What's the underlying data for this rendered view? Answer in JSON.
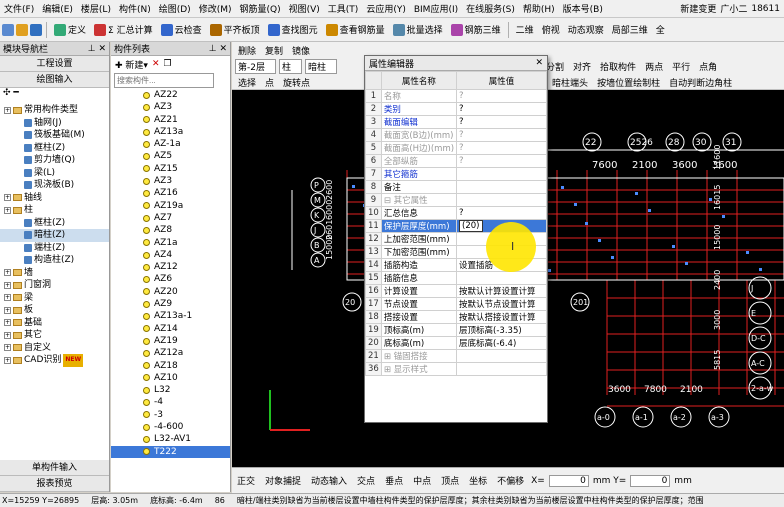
{
  "menubar": {
    "items": [
      "文件(F)",
      "编辑(E)",
      "楼层(L)",
      "构件(N)",
      "绘图(D)",
      "修改(M)",
      "钢筋量(Q)",
      "视图(V)",
      "工具(T)",
      "云应用(Y)",
      "BIM应用(I)",
      "在线服务(S)",
      "帮助(H)",
      "版本号(B)"
    ],
    "new_change": "新建变更",
    "user": "广小二",
    "phone": "18611"
  },
  "toolbar1": {
    "items": [
      "定义",
      "Σ 汇总计算",
      "云检查",
      "平齐板顶",
      "查找图元",
      "查看钢筋量",
      "批量选择",
      "钢筋三维"
    ],
    "right": [
      "二维",
      "俯视",
      "动态观察",
      "局部三维",
      "全"
    ]
  },
  "toolbar2": {
    "row1": [
      "删除",
      "复制",
      "镜像"
    ],
    "floor": "第-2层",
    "type": "柱",
    "sub": "暗柱",
    "right1": [
      "分割",
      "对齐"
    ],
    "row2": [
      "选择",
      "点",
      "旋转点"
    ],
    "right2": [
      "拾取构件",
      "两点",
      "平行",
      "点角"
    ],
    "row3": [
      "暗柱端头",
      "按墙位置绘制柱",
      "自动判断边角柱"
    ]
  },
  "leftpanel": {
    "title": "模块导航栏",
    "btn1": "工程设置",
    "btn2": "绘图输入",
    "tree": [
      {
        "label": "常用构件类型",
        "level": 1,
        "kind": "folder"
      },
      {
        "label": "轴网(J)",
        "level": 2,
        "kind": "leaf"
      },
      {
        "label": "筏板基础(M)",
        "level": 2,
        "kind": "leaf"
      },
      {
        "label": "框柱(Z)",
        "level": 2,
        "kind": "leaf"
      },
      {
        "label": "剪力墙(Q)",
        "level": 2,
        "kind": "leaf"
      },
      {
        "label": "梁(L)",
        "level": 2,
        "kind": "leaf"
      },
      {
        "label": "现浇板(B)",
        "level": 2,
        "kind": "leaf"
      },
      {
        "label": "轴线",
        "level": 1,
        "kind": "folder"
      },
      {
        "label": "柱",
        "level": 1,
        "kind": "folder"
      },
      {
        "label": "框柱(Z)",
        "level": 2,
        "kind": "leaf"
      },
      {
        "label": "暗柱(Z)",
        "level": 2,
        "kind": "leaf",
        "selected": true
      },
      {
        "label": "端柱(Z)",
        "level": 2,
        "kind": "leaf"
      },
      {
        "label": "构造柱(Z)",
        "level": 2,
        "kind": "leaf"
      },
      {
        "label": "墙",
        "level": 1,
        "kind": "folder"
      },
      {
        "label": "门窗洞",
        "level": 1,
        "kind": "folder"
      },
      {
        "label": "梁",
        "level": 1,
        "kind": "folder"
      },
      {
        "label": "板",
        "level": 1,
        "kind": "folder"
      },
      {
        "label": "基础",
        "level": 1,
        "kind": "folder"
      },
      {
        "label": "其它",
        "level": 1,
        "kind": "folder"
      },
      {
        "label": "自定义",
        "level": 1,
        "kind": "folder"
      },
      {
        "label": "CAD识别",
        "level": 1,
        "kind": "folder",
        "badge": "NEW"
      }
    ],
    "bottom1": "单构件输入",
    "bottom2": "报表预览"
  },
  "midpanel": {
    "title": "构件列表",
    "new_btn": "新建",
    "search_placeholder": "搜索构件...",
    "items": [
      "AZ22",
      "AZ3",
      "AZ21",
      "AZ13a",
      "AZ-1a",
      "AZ5",
      "AZ15",
      "AZ3",
      "AZ16",
      "AZ19a",
      "AZ7",
      "AZ8",
      "AZ1a",
      "AZ4",
      "AZ12",
      "AZ6",
      "AZ20",
      "AZ9",
      "AZ13a-1",
      "AZ14",
      "AZ19",
      "AZ12a",
      "AZ18",
      "AZ10",
      "L32",
      "-4",
      "-3",
      "-4-600",
      "L32-AV1",
      "T222"
    ],
    "selected_index": 29
  },
  "dialog": {
    "title": "属性编辑器",
    "col_name": "属性名称",
    "col_value": "属性值",
    "rows": [
      {
        "n": "1",
        "name": "名称",
        "value": "?",
        "style": "gray"
      },
      {
        "n": "2",
        "name": "类别",
        "value": "?",
        "style": "blue"
      },
      {
        "n": "3",
        "name": "截面编辑",
        "value": "?",
        "style": "blue"
      },
      {
        "n": "4",
        "name": "截面宽(B边)(mm)",
        "value": "?",
        "style": "gray"
      },
      {
        "n": "5",
        "name": "截面高(H边)(mm)",
        "value": "?",
        "style": "gray"
      },
      {
        "n": "6",
        "name": "全部纵筋",
        "value": "?",
        "style": "gray"
      },
      {
        "n": "7",
        "name": "其它箍筋",
        "value": "",
        "style": "blue"
      },
      {
        "n": "8",
        "name": "备注",
        "value": "",
        "style": ""
      },
      {
        "n": "9",
        "name": "⊟ 其它属性",
        "value": "",
        "style": "gray"
      },
      {
        "n": "10",
        "name": "汇总信息",
        "value": "?",
        "style": ""
      },
      {
        "n": "11",
        "name": "保护层厚度(mm)",
        "value": "(20)",
        "style": "hl"
      },
      {
        "n": "12",
        "name": "上加密范围(mm)",
        "value": "",
        "style": ""
      },
      {
        "n": "13",
        "name": "下加密范围(mm)",
        "value": "",
        "style": ""
      },
      {
        "n": "14",
        "name": "插筋构造",
        "value": "设置插筋",
        "style": ""
      },
      {
        "n": "15",
        "name": "插筋信息",
        "value": "",
        "style": ""
      },
      {
        "n": "16",
        "name": "计算设置",
        "value": "按默认计算设置计算",
        "style": ""
      },
      {
        "n": "17",
        "name": "节点设置",
        "value": "按默认节点设置计算",
        "style": ""
      },
      {
        "n": "18",
        "name": "搭接设置",
        "value": "按默认搭接设置计算",
        "style": ""
      },
      {
        "n": "19",
        "name": "顶标高(m)",
        "value": "层顶标高(-3.35)",
        "style": ""
      },
      {
        "n": "20",
        "name": "底标高(m)",
        "value": "层底标高(-6.4)",
        "style": ""
      },
      {
        "n": "21",
        "name": "⊞ 锚固搭接",
        "value": "",
        "style": "gray"
      },
      {
        "n": "36",
        "name": "⊞ 显示样式",
        "value": "",
        "style": "gray"
      }
    ]
  },
  "canvas": {
    "top_dims": [
      "22",
      "2526",
      "28",
      "30",
      "31"
    ],
    "dims2": [
      "7600",
      "2100",
      "3600",
      "3600"
    ],
    "left_axes": [
      "P",
      "M",
      "K",
      "J",
      "B",
      "A"
    ],
    "right_axes": [
      "J",
      "E",
      "D-C",
      "A-C",
      "2-a-w"
    ],
    "bottom_axes": [
      "a-0",
      "a-1",
      "a-2",
      "a-3"
    ],
    "left_dims": [
      "15000",
      "2601",
      "6000",
      "2600"
    ],
    "bottom_dims": [
      "3600",
      "7800",
      "2100"
    ],
    "circles_mid": [
      "20",
      "20",
      "201"
    ],
    "right_dims": [
      "5815",
      "3000",
      "2400",
      "15000",
      "16015",
      "11600"
    ]
  },
  "bottomtb": {
    "items": [
      "正交",
      "对象捕捉",
      "动态输入",
      "交点",
      "垂点",
      "中点",
      "顶点",
      "坐标",
      "不偏移"
    ],
    "x_label": "X=",
    "x_val": "0",
    "y_label": "mm Y=",
    "y_val": "0",
    "mm": "mm"
  },
  "statusbar": {
    "coords": "X=15259 Y=26895",
    "floor_h": "层高: 3.05m",
    "bottom_el": "底标高: -6.4m",
    "num": "86",
    "msg": "暗柱/端柱类别缺省为当前楼层设置中墙柱构件类型的保护层厚度；其余柱类别缺省为当前楼层设置中柱构件类型的保护层厚度；范围"
  }
}
